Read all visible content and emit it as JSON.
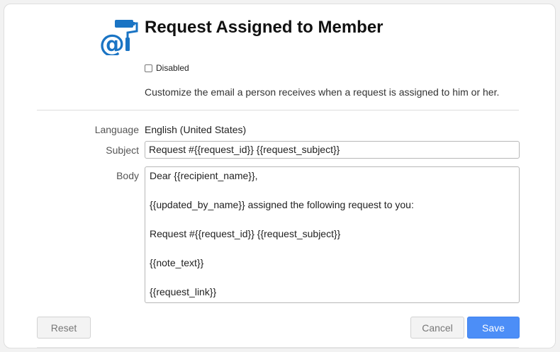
{
  "header": {
    "title": "Request Assigned to Member",
    "logo_icon": "at-sign-paint-roller-icon",
    "accent_color": "#1a74c4"
  },
  "disabled": {
    "label": "Disabled",
    "checked": false
  },
  "description": "Customize the email a person receives when a request is assigned to him or her.",
  "form": {
    "language_label": "Language",
    "language_value": "English (United States)",
    "subject_label": "Subject",
    "subject_value": "Request #{{request_id}} {{request_subject}}",
    "body_label": "Body",
    "body_lines": [
      "Dear {{recipient_name}},",
      "{{updated_by_name}} assigned the following request to you:",
      "Request #{{request_id}} {{request_subject}}",
      "{{note_text}}",
      "{{request_link}}"
    ]
  },
  "buttons": {
    "reset": "Reset",
    "cancel": "Cancel",
    "save": "Save",
    "save_color": "#4c8ef7"
  }
}
